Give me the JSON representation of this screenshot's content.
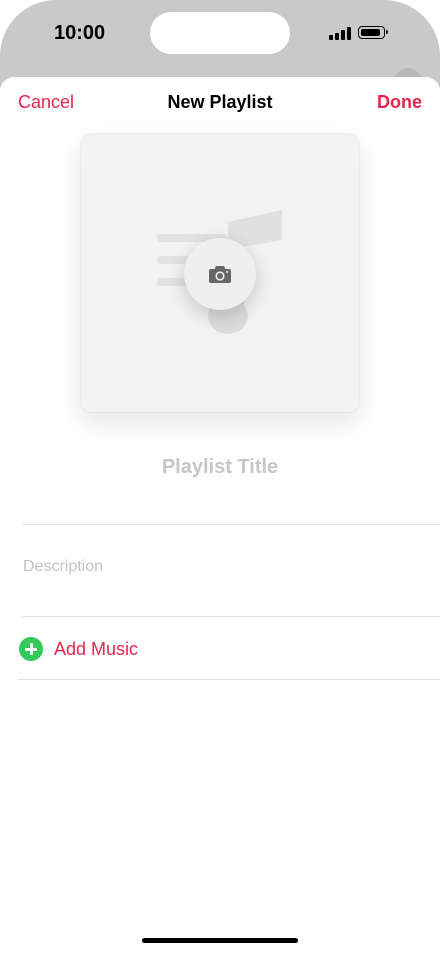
{
  "status_bar": {
    "time": "10:00",
    "signal_icon": "signal-icon",
    "battery_icon": "battery-icon"
  },
  "nav": {
    "cancel_label": "Cancel",
    "title": "New Playlist",
    "done_label": "Done"
  },
  "artwork": {
    "placeholder_icon": "music-note-icon",
    "camera_icon": "camera-icon"
  },
  "form": {
    "title_placeholder": "Playlist Title",
    "description_placeholder": "Description",
    "add_music_label": "Add Music",
    "add_music_icon": "plus-circle-icon"
  },
  "colors": {
    "accent": "#e8244e",
    "add_green": "#34c759",
    "placeholder_gray": "#c6c6c6"
  }
}
